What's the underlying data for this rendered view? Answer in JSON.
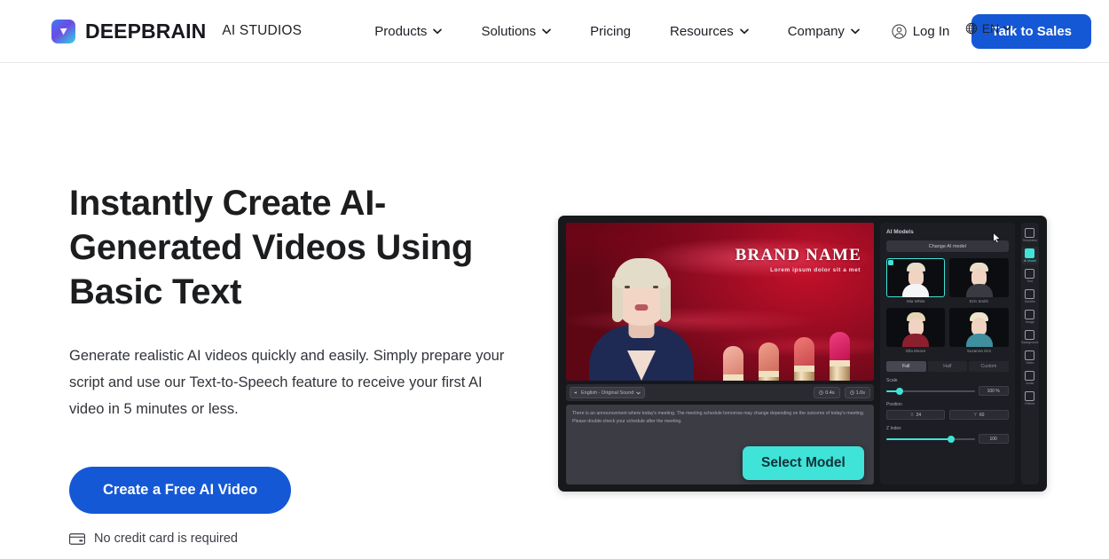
{
  "header": {
    "logo": {
      "icon": "deepbrain-cube-logo",
      "name": "DEEPBRAIN",
      "sub": "AI STUDIOS"
    },
    "nav": [
      {
        "label": "Products",
        "has_caret": true
      },
      {
        "label": "Solutions",
        "has_caret": true
      },
      {
        "label": "Pricing",
        "has_caret": false
      },
      {
        "label": "Resources",
        "has_caret": true
      },
      {
        "label": "Company",
        "has_caret": true
      }
    ],
    "language": {
      "icon": "globe-icon",
      "label": "EN"
    },
    "login": {
      "icon": "user-circle-icon",
      "label": "Log In"
    },
    "cta": {
      "label": "Talk to Sales",
      "color": "#1558d6"
    }
  },
  "hero": {
    "title": "Instantly Create AI-Generated Videos Using Basic Text",
    "subtitle": "Generate realistic AI videos quickly and easily. Simply prepare your script and use our Text-to-Speech feature to receive your first AI video in 5 minutes or less.",
    "cta_label": "Create a Free AI Video",
    "cta_color": "#1558d6",
    "note_icon": "credit-card-icon",
    "note": "No credit card is required"
  },
  "editor": {
    "canvas": {
      "brand_name": "BRAND NAME",
      "brand_tagline": "Lorem ipsum dolor sit a met"
    },
    "video_toolbar": {
      "language_chip": {
        "icon": "sound-icon",
        "label": "English - Original Sound"
      },
      "time_chips": [
        {
          "icon": "clock-icon",
          "label": "0.4s"
        },
        {
          "icon": "clock-icon",
          "label": "1.0s"
        }
      ]
    },
    "script": "There is an announcement where today's meeting. The meeting schedule tomorrow may change depending on the outcome of today's meeting. Please double-check your schedule after the meeting.",
    "select_model_button": {
      "label": "Select Model",
      "color": "#3fe3d8"
    },
    "panel": {
      "title": "AI Models",
      "change_button": "Change AI model",
      "models": [
        {
          "label": "Mia White",
          "selected": true,
          "hair": "#e3dcc8",
          "body": "#f4f5f7"
        },
        {
          "label": "Erin Smith",
          "selected": false,
          "hair": "#e8dfc9",
          "body": "#3a3b42"
        },
        {
          "label": "Ella Moore",
          "selected": false,
          "hair": "#e4d6b4",
          "body": "#8c1f2e"
        },
        {
          "label": "Suzanne Kim",
          "selected": false,
          "hair": "#efe4cc",
          "body": "#3f8f9e"
        }
      ],
      "tabs": [
        {
          "label": "Full",
          "active": true
        },
        {
          "label": "Half",
          "active": false
        },
        {
          "label": "Custom",
          "active": false
        }
      ],
      "controls": {
        "scale": {
          "label": "Scale",
          "value": "100 %",
          "percent": 14
        },
        "position": {
          "label": "Position",
          "x_key": "X",
          "x_value": "24",
          "y_key": "Y",
          "y_value": "60"
        },
        "z_index": {
          "label": "Z Index",
          "value": "100",
          "percent": 72
        }
      }
    },
    "rail": [
      {
        "label": "Templates",
        "icon": "templates-icon",
        "active": false
      },
      {
        "label": "AI Model",
        "icon": "avatar-icon",
        "active": true
      },
      {
        "label": "Text",
        "icon": "text-icon",
        "active": false
      },
      {
        "label": "Subtitle",
        "icon": "subtitle-icon",
        "active": false
      },
      {
        "label": "Image",
        "icon": "image-icon",
        "active": false
      },
      {
        "label": "Background",
        "icon": "background-icon",
        "active": false
      },
      {
        "label": "Video",
        "icon": "video-icon",
        "active": false
      },
      {
        "label": "Audio",
        "icon": "audio-icon",
        "active": false
      },
      {
        "label": "Effects",
        "icon": "effects-icon",
        "active": false
      }
    ]
  }
}
